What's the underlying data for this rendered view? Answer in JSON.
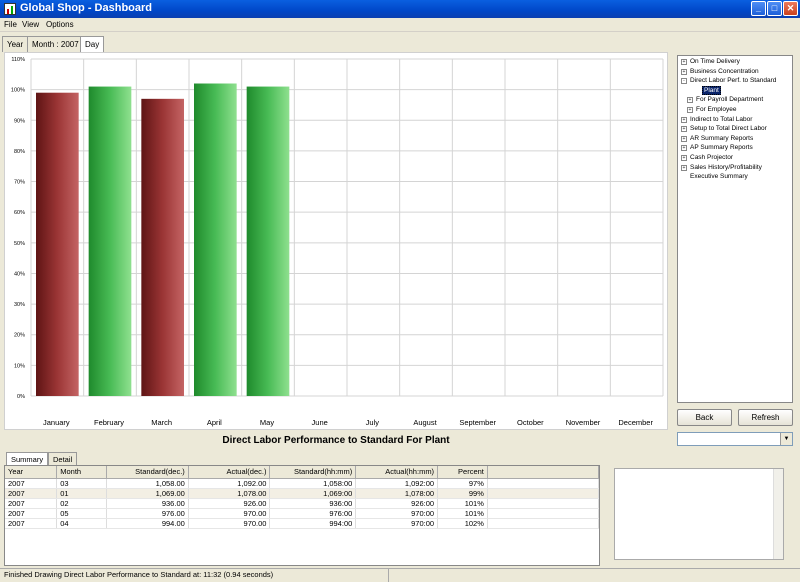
{
  "window": {
    "title": "Global Shop - Dashboard",
    "controls": [
      "_",
      "□",
      "✕"
    ]
  },
  "menu": [
    "File",
    "View",
    "Options"
  ],
  "top_tabs": [
    {
      "label": "Year",
      "active": false
    },
    {
      "label": "Month : 2007",
      "active": false
    },
    {
      "label": "Day",
      "active": true
    }
  ],
  "chart_title": "Direct Labor Performance to Standard For Plant",
  "chart_data": {
    "type": "bar",
    "categories": [
      "January",
      "February",
      "March",
      "April",
      "May",
      "June",
      "July",
      "August",
      "September",
      "October",
      "November",
      "December"
    ],
    "values": [
      99,
      101,
      97,
      102,
      101,
      null,
      null,
      null,
      null,
      null,
      null,
      null
    ],
    "ylim": [
      0,
      110
    ],
    "yticks": [
      "0%",
      "10%",
      "20%",
      "30%",
      "40%",
      "50%",
      "60%",
      "70%",
      "80%",
      "90%",
      "100%",
      "110%"
    ],
    "grid": true,
    "colors": {
      "below": "#8b2a2a",
      "above": "#3fb54a"
    }
  },
  "tree": [
    {
      "label": "On Time Delivery",
      "toggle": "+",
      "level": 0
    },
    {
      "label": "Business Concentration",
      "toggle": "+",
      "level": 0
    },
    {
      "label": "Direct Labor Perf. to Standard",
      "toggle": "-",
      "level": 0
    },
    {
      "label": "Plant",
      "toggle": "",
      "level": 2,
      "selected": true
    },
    {
      "label": "For Payroll Department",
      "toggle": "+",
      "level": 1
    },
    {
      "label": "For Employee",
      "toggle": "+",
      "level": 1
    },
    {
      "label": "Indirect to Total Labor",
      "toggle": "+",
      "level": 0
    },
    {
      "label": "Setup to Total Direct Labor",
      "toggle": "+",
      "level": 0
    },
    {
      "label": "AR Summary Reports",
      "toggle": "+",
      "level": 0
    },
    {
      "label": "AP Summary Reports",
      "toggle": "+",
      "level": 0
    },
    {
      "label": "Cash Projector",
      "toggle": "+",
      "level": 0
    },
    {
      "label": "Sales History/Profitability",
      "toggle": "+",
      "level": 0
    },
    {
      "label": "Executive Summary",
      "toggle": "",
      "level": 0
    }
  ],
  "buttons": {
    "back": "Back",
    "refresh": "Refresh"
  },
  "bottom_tabs": [
    {
      "label": "Summary",
      "active": true
    },
    {
      "label": "Detail",
      "active": false
    }
  ],
  "table": {
    "columns": [
      "Year",
      "Month",
      "Standard(dec.)",
      "Actual(dec.)",
      "Standard(hh:mm)",
      "Actual(hh:mm)",
      "Percent"
    ],
    "rows": [
      [
        "2007",
        "03",
        "1,058.00",
        "1,092.00",
        "1,058:00",
        "1,092:00",
        "97%"
      ],
      [
        "2007",
        "01",
        "1,069.00",
        "1,078.00",
        "1,069:00",
        "1,078:00",
        "99%"
      ],
      [
        "2007",
        "02",
        "936.00",
        "926.00",
        "936:00",
        "926:00",
        "101%"
      ],
      [
        "2007",
        "05",
        "976.00",
        "970.00",
        "976:00",
        "970:00",
        "101%"
      ],
      [
        "2007",
        "04",
        "994.00",
        "970.00",
        "994:00",
        "970:00",
        "102%"
      ]
    ]
  },
  "status": "Finished Drawing Direct Labor Performance to Standard at: 11:32 (0.94 seconds)"
}
